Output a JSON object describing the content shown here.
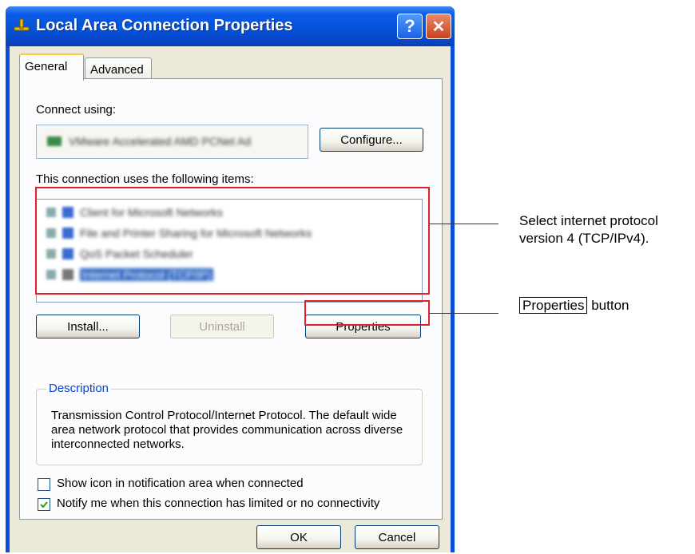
{
  "window": {
    "title": "Local Area Connection Properties",
    "help_label": "?",
    "close_label": "✕"
  },
  "tabs": [
    {
      "label": "General",
      "active": true
    },
    {
      "label": "Advanced",
      "active": false
    }
  ],
  "connect_using": {
    "label": "Connect using:",
    "adapter_name": "VMware Accelerated AMD PCNet Ad",
    "configure_label": "Configure..."
  },
  "items_section": {
    "label": "This connection uses the following items:",
    "items": [
      {
        "label": "Client for Microsoft Networks",
        "checked": true,
        "selected": false
      },
      {
        "label": "File and Printer Sharing for Microsoft Networks",
        "checked": true,
        "selected": false
      },
      {
        "label": "QoS Packet Scheduler",
        "checked": true,
        "selected": false
      },
      {
        "label": "Internet Protocol (TCP/IP)",
        "checked": true,
        "selected": true
      }
    ]
  },
  "buttons": {
    "install": "Install...",
    "uninstall": "Uninstall",
    "properties": "Properties",
    "ok": "OK",
    "cancel": "Cancel"
  },
  "description": {
    "title": "Description",
    "text": "Transmission Control Protocol/Internet Protocol. The default wide area network protocol that provides communication across diverse interconnected networks."
  },
  "checkboxes": [
    {
      "label": "Show icon in notification area when connected",
      "checked": false
    },
    {
      "label": "Notify me when this connection has limited or no connectivity",
      "checked": true
    }
  ],
  "callouts": {
    "protocol_line1": "Select internet protocol",
    "protocol_line2": "version 4 (TCP/IPv4).",
    "properties_boxed": "Properties",
    "properties_suffix": " button"
  },
  "colors": {
    "titlebar": "#0653d8",
    "highlight_box": "#e0202a",
    "selection": "#316ac5"
  }
}
